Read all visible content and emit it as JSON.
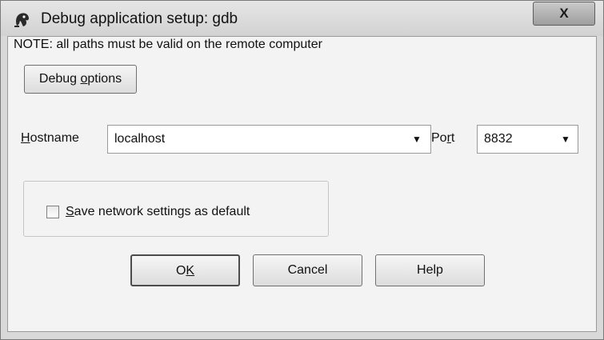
{
  "window": {
    "title": "Debug application setup: gdb",
    "close_glyph": "X"
  },
  "note": "NOTE: all paths must be valid on the remote computer",
  "debug_options": {
    "label_pre": "Debug ",
    "label_mnemonic": "o",
    "label_post": "ptions"
  },
  "hostname": {
    "label_mnemonic": "H",
    "label_post": "ostname",
    "value": "localhost"
  },
  "port": {
    "label_pre": "Po",
    "label_mnemonic": "r",
    "label_post": "t",
    "value": "8832"
  },
  "save_default": {
    "checked": false,
    "label_mnemonic": "S",
    "label_post": "ave network settings as default"
  },
  "buttons": {
    "ok_pre": "O",
    "ok_mnemonic": "K",
    "cancel": "Cancel",
    "help": "Help"
  },
  "icons": {
    "app": "app-icon",
    "dropdown": "chevron-down-icon"
  }
}
